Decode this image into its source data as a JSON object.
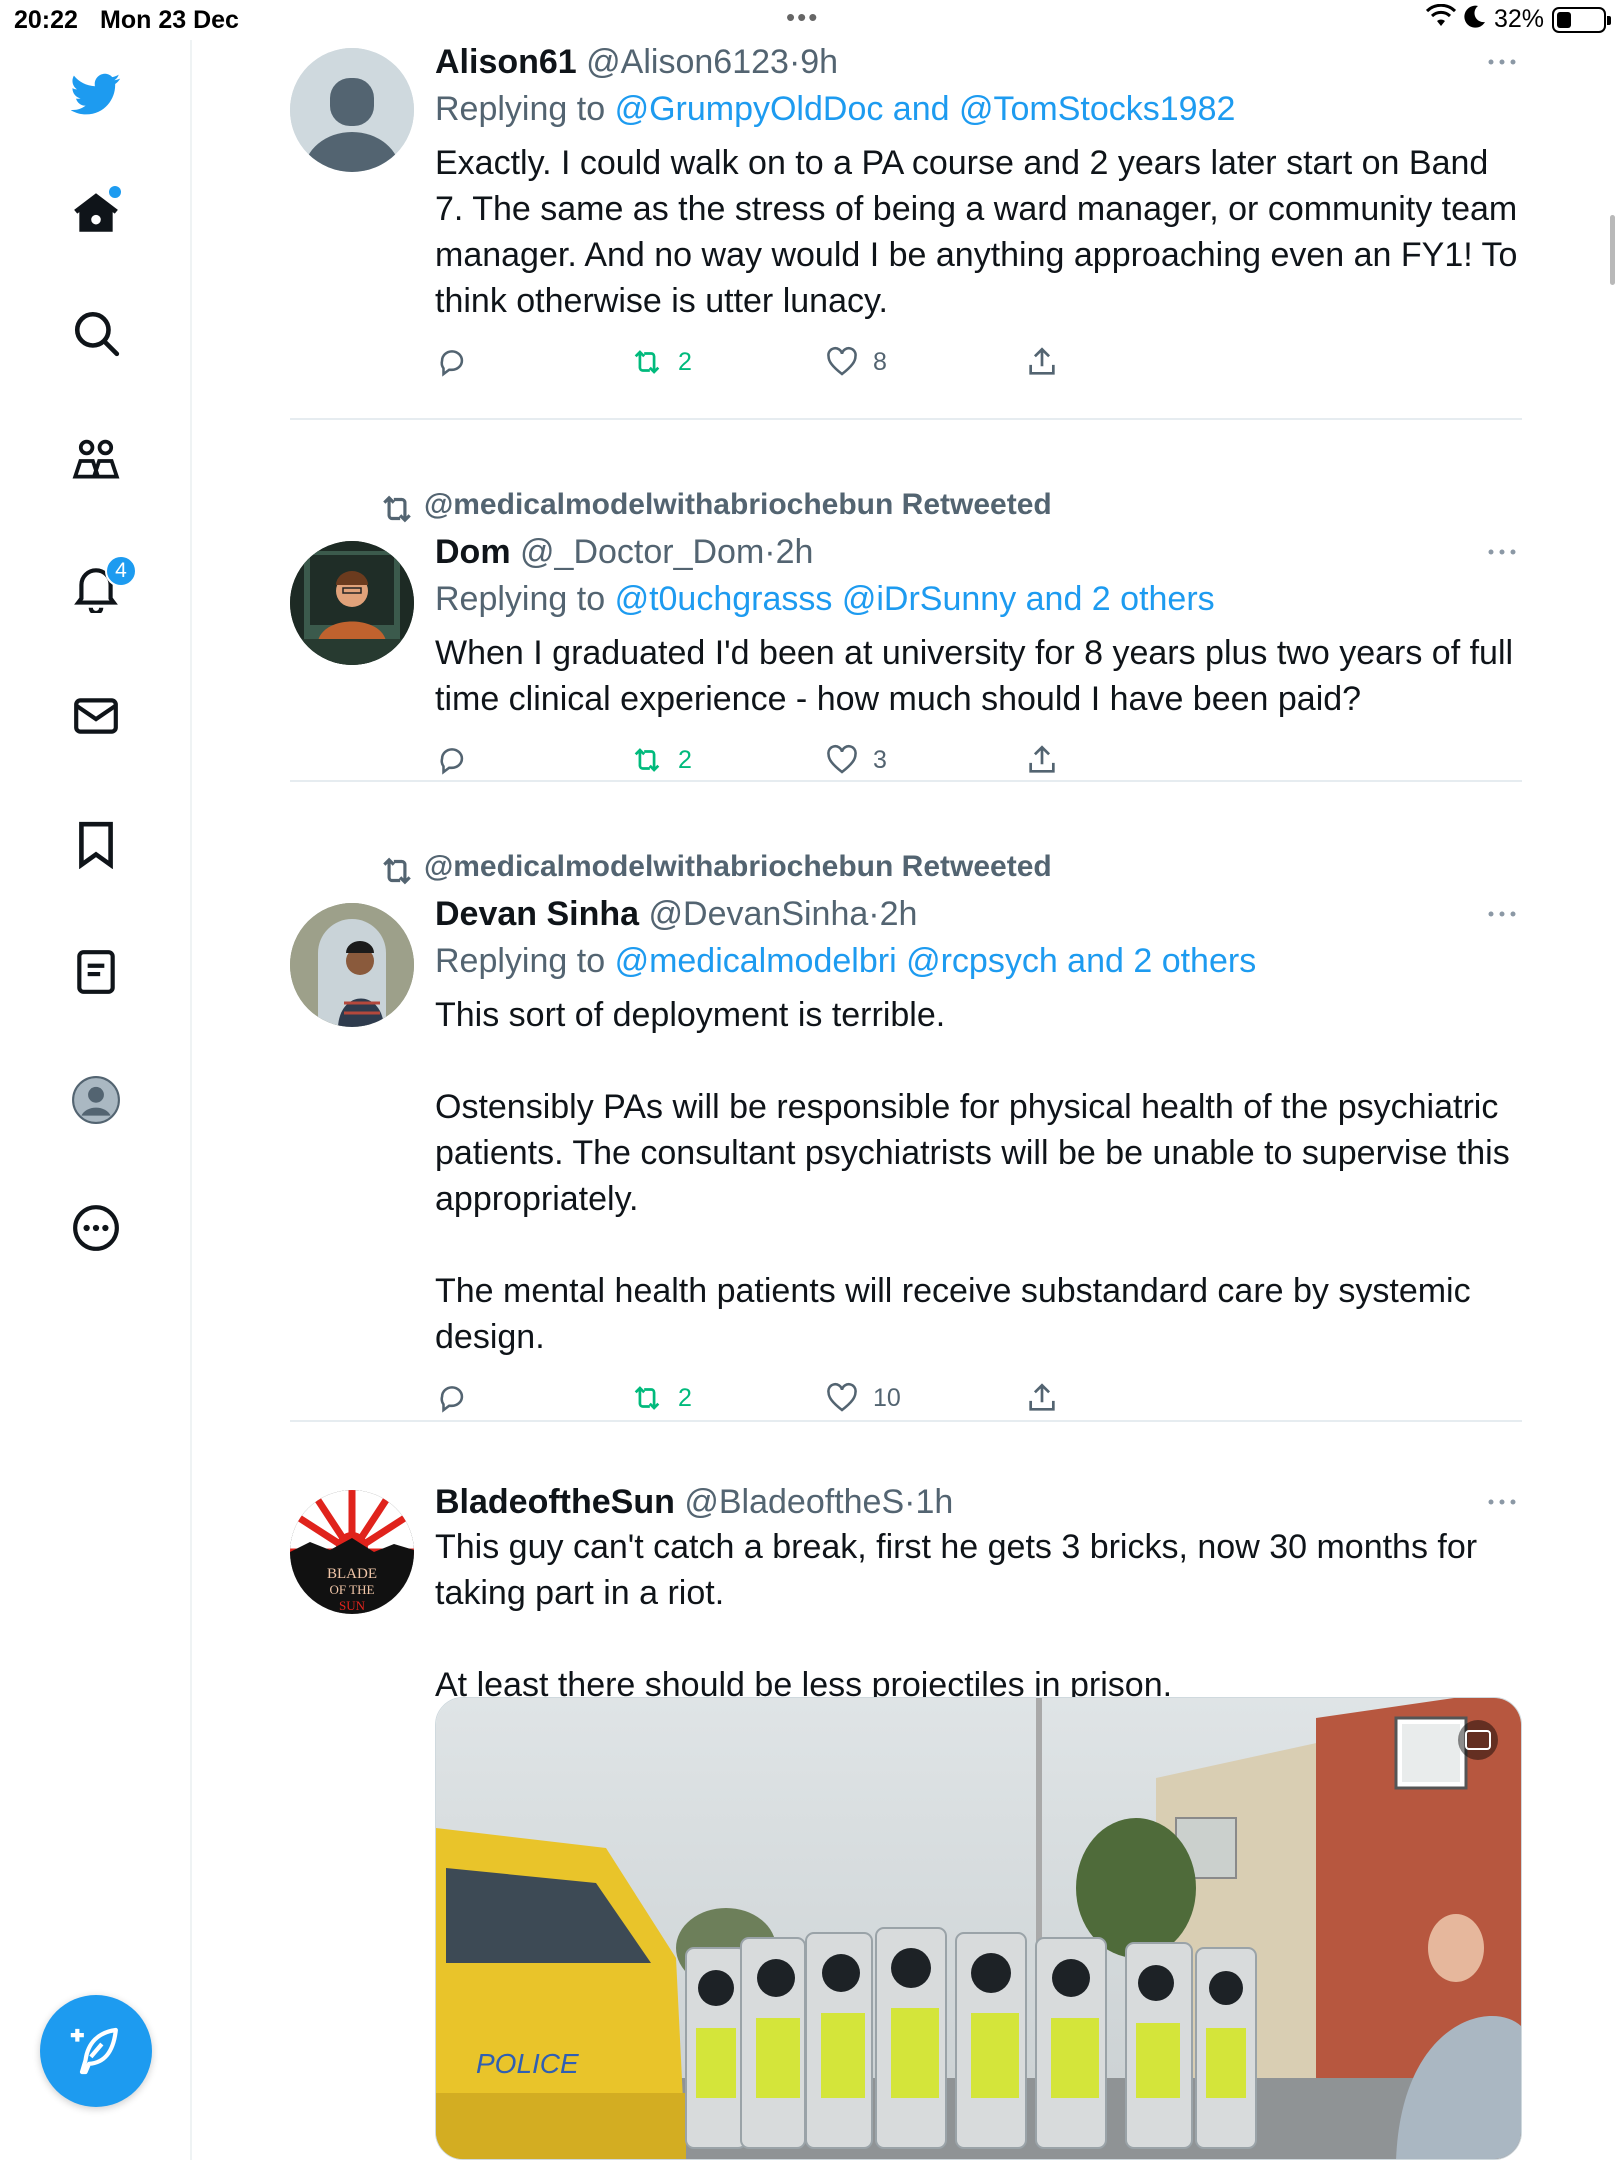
{
  "status_bar": {
    "time": "20:22",
    "date": "Mon 23 Dec",
    "battery_percent": "32%",
    "battery_level": 0.32
  },
  "sidebar": {
    "items": [
      {
        "icon": "twitter-logo-icon"
      },
      {
        "icon": "home-icon",
        "has_dot": true
      },
      {
        "icon": "search-icon"
      },
      {
        "icon": "communities-icon"
      },
      {
        "icon": "notifications-icon",
        "badge": "4"
      },
      {
        "icon": "messages-icon"
      },
      {
        "icon": "bookmarks-icon"
      },
      {
        "icon": "lists-icon"
      },
      {
        "icon": "profile-icon"
      },
      {
        "icon": "more-icon"
      }
    ],
    "compose_icon": "compose-tweet-icon"
  },
  "colors": {
    "accent": "#1d9bf0",
    "retweet": "#00ba7c",
    "muted": "#536471",
    "text": "#0f1419"
  },
  "tweets": [
    {
      "name": "Alison61",
      "handle": "@Alison6123",
      "sep": "·",
      "time": "9h",
      "replying_prefix": "Replying to",
      "replying_links": "@GrumpyOldDoc and @TomStocks1982",
      "text": [
        "Exactly. I could walk on to a PA course and 2 years later start on Band 7. The same as the stress of being a ward manager, or community team manager. And no way would I be anything approaching even an FY1! To think otherwise is utter lunacy."
      ],
      "retweets": "2",
      "likes": "8"
    },
    {
      "retweeted_by": "@medicalmodelwithabriochebun Retweeted",
      "name": "Dom",
      "handle": "@_Doctor_Dom",
      "sep": "·",
      "time": "2h",
      "replying_prefix": "Replying to",
      "replying_links": "@t0uchgrasss @iDrSunny and 2 others",
      "text": [
        "When I graduated I'd been at university for 8 years plus two years of full time clinical experience - how much should I have been paid?"
      ],
      "retweets": "2",
      "likes": "3"
    },
    {
      "retweeted_by": "@medicalmodelwithabriochebun Retweeted",
      "name": "Devan Sinha",
      "handle": "@DevanSinha",
      "sep": "·",
      "time": "2h",
      "replying_prefix": "Replying to",
      "replying_links": "@medicalmodelbri @rcpsych and 2 others",
      "text": [
        "This sort of deployment is terrible.",
        "Ostensibly PAs will be responsible for physical health of the psychiatric patients. The consultant psychiatrists will be be unable to supervise this appropriately.",
        "The mental health patients will receive substandard care by systemic design."
      ],
      "retweets": "2",
      "likes": "10"
    },
    {
      "name": "BladeoftheSun",
      "handle": "@BladeoftheS",
      "sep": "·",
      "time": "1h",
      "text": [
        "This guy can't catch a break, first he gets 3 bricks, now 30 months for taking part in a riot.",
        "At least there should be less projectiles in prison."
      ],
      "avatar_text": "BLADE OF THE SUN"
    }
  ]
}
